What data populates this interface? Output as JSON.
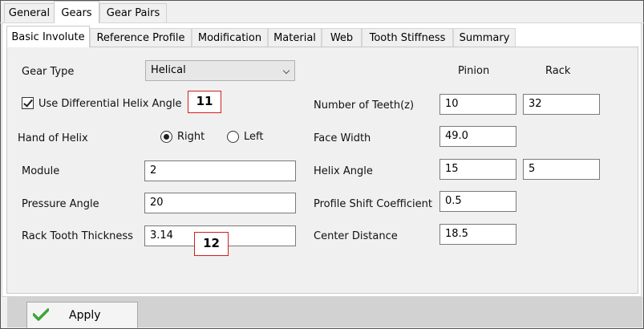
{
  "top_tabs": [
    {
      "label": "General",
      "active": false
    },
    {
      "label": "Gears",
      "active": true
    },
    {
      "label": "Gear Pairs",
      "active": false
    }
  ],
  "sub_tabs": [
    {
      "label": "Basic Involute",
      "active": true
    },
    {
      "label": "Reference Profile",
      "active": false
    },
    {
      "label": "Modification",
      "active": false
    },
    {
      "label": "Material",
      "active": false
    },
    {
      "label": "Web",
      "active": false
    },
    {
      "label": "Tooth Stiffness",
      "active": false
    },
    {
      "label": "Summary",
      "active": false
    }
  ],
  "left": {
    "gear_type_label": "Gear Type",
    "gear_type_value": "Helical",
    "differential_helix_label": "Use Differential Helix Angle",
    "differential_helix_checked": true,
    "hand_of_helix_label": "Hand of Helix",
    "right_label": "Right",
    "left_label": "Left",
    "hand_selected": "Right",
    "module_label": "Module",
    "module_value": "2",
    "pressure_angle_label": "Pressure Angle",
    "pressure_angle_value": "20",
    "rack_tooth_thickness_label": "Rack Tooth Thickness",
    "rack_tooth_thickness_value": "3.14"
  },
  "right": {
    "pinion_header": "Pinion",
    "rack_header": "Rack",
    "number_of_teeth_label": "Number of Teeth(z)",
    "teeth_pinion": "10",
    "teeth_rack": "32",
    "face_width_label": "Face Width",
    "face_width_value": "49.0",
    "helix_angle_label": "Helix Angle",
    "helix_pinion": "15",
    "helix_rack": "5",
    "profile_shift_label": "Profile Shift Coefficient",
    "profile_shift_value": "0.5",
    "center_distance_label": "Center Distance",
    "center_distance_value": "18.5"
  },
  "callouts": {
    "a": "11",
    "b": "12"
  },
  "footer": {
    "apply_label": "Apply"
  },
  "colors": {
    "callout_border": "#d21e1e",
    "check_icon": "#3aa53a"
  }
}
